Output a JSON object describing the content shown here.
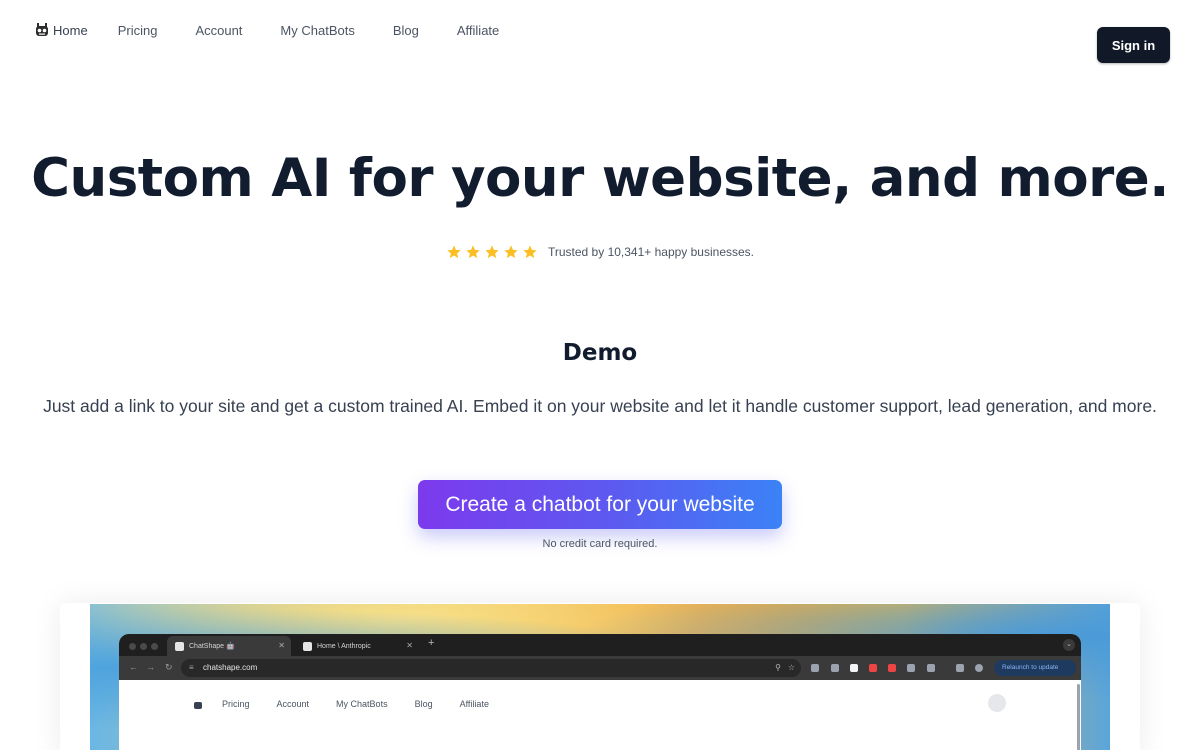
{
  "nav": {
    "home": "Home",
    "pricing": "Pricing",
    "account": "Account",
    "chatbots": "My ChatBots",
    "blog": "Blog",
    "affiliate": "Affiliate",
    "signin": "Sign in"
  },
  "hero": {
    "title": "Custom AI for your website, and more.",
    "rating_stars": 5,
    "trust_text": "Trusted by 10,341+ happy businesses."
  },
  "demo": {
    "title": "Demo",
    "description": "Just add a link to your site and get a custom trained AI. Embed it on your website and let it handle customer support, lead generation, and more.",
    "cta": "Create a chatbot for your website",
    "note": "No credit card required."
  },
  "screenshot": {
    "tabs": [
      {
        "title": "ChatShape 🤖"
      },
      {
        "title": "Home \\ Anthropic"
      }
    ],
    "url": "chatshape.com",
    "relaunch": "Relaunch to update",
    "inner_nav": [
      "Pricing",
      "Account",
      "My ChatBots",
      "Blog",
      "Affiliate"
    ]
  },
  "colors": {
    "title": "#111c2e",
    "signin_bg": "#111827",
    "star": "#fbbf24",
    "cta_start": "#7c3aed",
    "cta_end": "#3b82f6"
  },
  "icons": [
    "robot-logo-icon",
    "star-icon",
    "close-icon",
    "plus-icon",
    "back-icon",
    "forward-icon",
    "reload-icon",
    "zoom-icon",
    "bookmark-star-icon",
    "chevron-down-icon"
  ]
}
